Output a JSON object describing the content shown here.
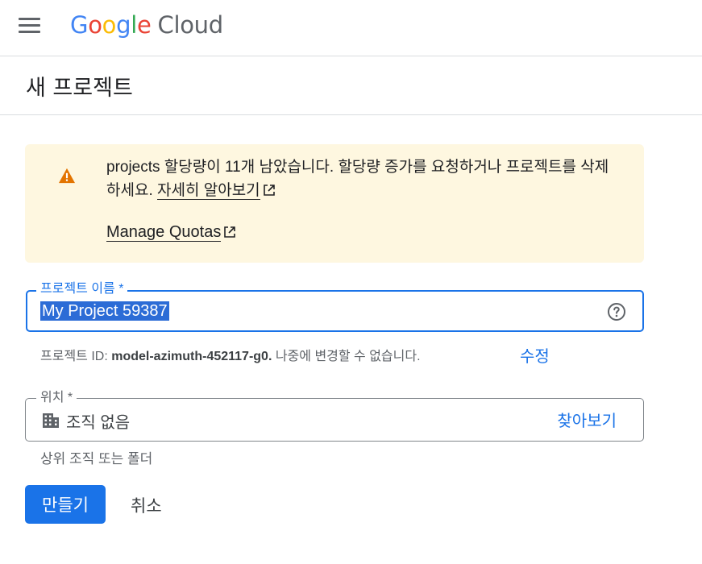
{
  "header": {
    "menu_icon": "hamburger-menu-icon",
    "logo": {
      "letters": [
        "G",
        "o",
        "o",
        "g",
        "l",
        "e"
      ],
      "product": "Cloud"
    }
  },
  "page": {
    "title": "새 프로젝트"
  },
  "quota_warning": {
    "icon": "warning-icon",
    "message": "projects 할당량이 11개 남았습니다. 할당량 증가를 요청하거나 프로젝트를 삭제하세요.",
    "learn_more": "자세히 알아보기",
    "manage_quotas": "Manage Quotas",
    "colors": {
      "background": "#fef7e0",
      "icon": "#e37400"
    }
  },
  "project_name": {
    "label": "프로젝트 이름 *",
    "value": "My Project 59387",
    "help_icon": "help-circle-icon",
    "hint_prefix": "프로젝트 ID: ",
    "project_id": "model-azimuth-452117-g0.",
    "hint_suffix": " 나중에 변경할 수 없습니다.",
    "edit_label": "수정"
  },
  "location": {
    "label": "위치 *",
    "icon": "building-icon",
    "value": "조직 없음",
    "browse_label": "찾아보기",
    "hint": "상위 조직 또는 폴더"
  },
  "actions": {
    "create_label": "만들기",
    "cancel_label": "취소"
  },
  "colors": {
    "accent": "#1a73e8",
    "border": "#dadce0"
  }
}
